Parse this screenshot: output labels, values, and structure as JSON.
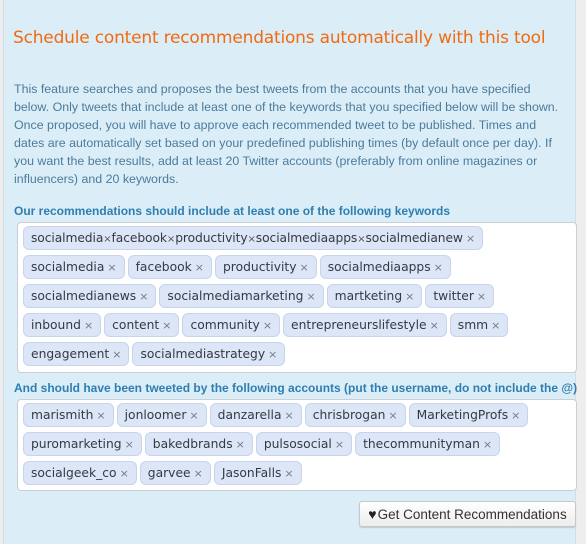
{
  "title": "Schedule content recommendations automatically with this tool",
  "intro": "This feature searches and proposes the best tweets from the accounts that you have specified below. Only tweets that include at least one of the keywords that you specified below will be shown. Once proposed, you will have to approve each recommended tweet to be published. Times and dates are automatically set based on your predefined publishing times (by default once per day). If you want the best results, add at least 20 Twitter accounts (preferably from online magazines or influencers) and 20 keywords.",
  "keywords": {
    "label": "Our recommendations should include at least one of the following keywords",
    "pending_input": [
      "socialmedia",
      "facebook",
      "productivity",
      "socialmediaapps",
      "socialmedianew"
    ],
    "tags": [
      "socialmedia",
      "facebook",
      "productivity",
      "socialmediaapps",
      "socialmedianews",
      "socialmediamarketing",
      "martketing",
      "twitter",
      "inbound",
      "content",
      "community",
      "entrepreneurslifestyle",
      "smm",
      "engagement",
      "socialmediastrategy"
    ]
  },
  "accounts": {
    "label": "And should have been tweeted by the following accounts (put the username, do not include the @)",
    "tags": [
      "marismith",
      "jonloomer",
      "danzarella",
      "chrisbrogan",
      "MarketingProfs",
      "puromarketing",
      "bakedbrands",
      "pulsosocial",
      "thecommunityman",
      "socialgeek_co",
      "garvee",
      "JasonFalls"
    ]
  },
  "remove_glyph": "×",
  "button": {
    "icon": "heart-icon",
    "label": "Get Content Recommendations"
  },
  "colors": {
    "title": "#f26a0f",
    "label": "#2f7eb0",
    "panel": "#dbeef8",
    "tag": "#dce6f7"
  }
}
